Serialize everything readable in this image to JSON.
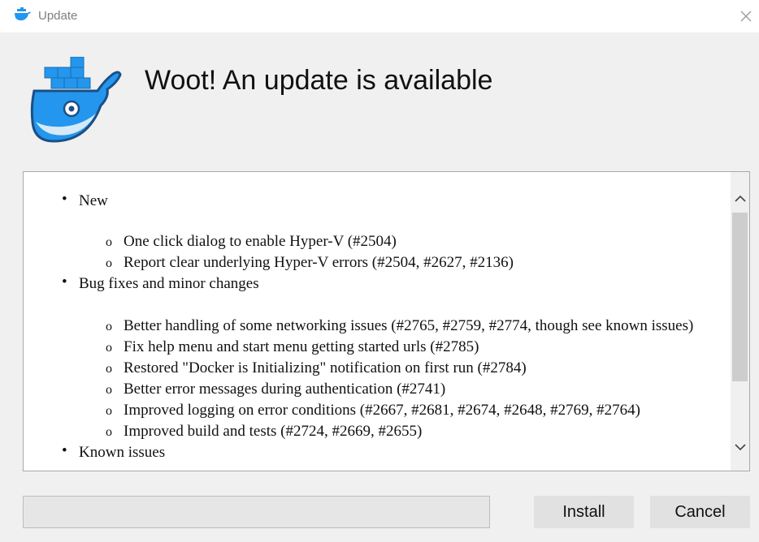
{
  "window": {
    "title": "Update",
    "close_glyph": "✕",
    "icons": {
      "title_icon": "docker-whale-icon",
      "logo": "docker-whale-logo",
      "close": "close-icon"
    }
  },
  "header": {
    "title": "Woot! An update is available"
  },
  "release_notes": {
    "sections": [
      {
        "label": "New",
        "items": [
          "One click dialog to enable Hyper-V (#2504)",
          "Report clear underlying Hyper-V errors (#2504, #2627, #2136)"
        ]
      },
      {
        "label": "Bug fixes and minor changes",
        "items": [
          "Better handling of some networking issues (#2765, #2759, #2774, though see known issues)",
          "Fix help menu and start menu getting started urls (#2785)",
          "Restored \"Docker is Initializing\" notification on first run (#2784)",
          "Better error messages during authentication (#2741)",
          "Improved logging on error conditions (#2667, #2681, #2674, #2648, #2769, #2764)",
          "Improved build and tests (#2724, #2669, #2655)"
        ]
      },
      {
        "label": "Known issues",
        "items": []
      }
    ],
    "bullet_glyph": "•",
    "sub_bullet_glyph": "o"
  },
  "footer": {
    "progress": 0,
    "install_label": "Install",
    "cancel_label": "Cancel"
  },
  "colors": {
    "docker_blue": "#2496ed",
    "window_bg": "#f0f0f0",
    "button_bg": "#e1e1e1"
  }
}
